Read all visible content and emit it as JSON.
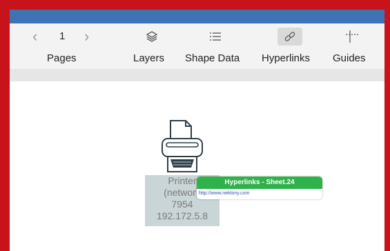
{
  "toolbar": {
    "pages": {
      "prev_icon": "chevron-left-icon",
      "current_page": "1",
      "next_icon": "chevron-right-icon",
      "label": "Pages"
    },
    "layers": {
      "icon": "layers-icon",
      "label": "Layers"
    },
    "shape_data": {
      "icon": "list-icon",
      "label": "Shape Data"
    },
    "hyperlinks": {
      "icon": "link-icon",
      "label": "Hyperlinks",
      "selected": true
    },
    "guides": {
      "icon": "guides-icon",
      "label": "Guides"
    }
  },
  "canvas": {
    "shape": {
      "icon": "printer-icon",
      "text_lines": [
        "Printer",
        "(network",
        "7954",
        "192.172.5.8"
      ]
    },
    "hyperlink_popup": {
      "title": "Hyperlinks - Sheet.24",
      "url": "http://www.nektony.com"
    }
  },
  "colors": {
    "frame_red": "#c6141a",
    "title_bar_blue": "#3e73b4",
    "popup_green": "#2fb24a",
    "shape_text_bg": "#c9d5d6"
  }
}
